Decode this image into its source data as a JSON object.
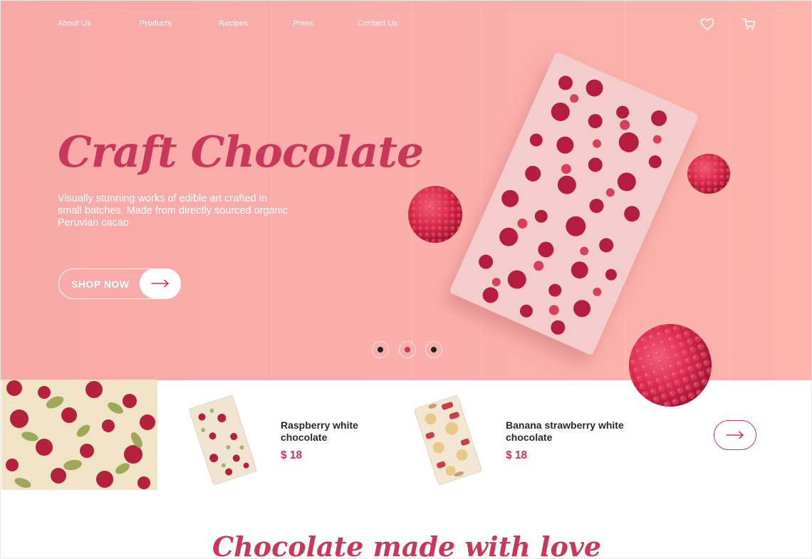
{
  "nav": {
    "items": [
      "About Us",
      "Products",
      "Recipes",
      "Press",
      "Contact Us"
    ],
    "wishlist_icon": "heart-icon",
    "cart_icon": "cart-icon"
  },
  "hero": {
    "title": "Craft Chocolate",
    "subtitle": "Visually stunning works of edible art crafted in small batches. Made from directly sourced organic Peruvian cacao",
    "cta_label": "SHOP NOW",
    "cta_icon": "arrow-right-icon",
    "slides_total": 3,
    "active_slide": 2
  },
  "products": [
    {
      "name": "Raspberry white chocolate",
      "price": "$ 18"
    },
    {
      "name": "Banana strawberry white chocolate",
      "price": "$ 18"
    }
  ],
  "carousel_next_icon": "arrow-right-icon",
  "section_heading": "Chocolate made with love",
  "colors": {
    "accent": "#c9385a",
    "hero_bg": "#fbaeab",
    "white": "#ffffff",
    "text_dark": "#2a2a2a"
  }
}
